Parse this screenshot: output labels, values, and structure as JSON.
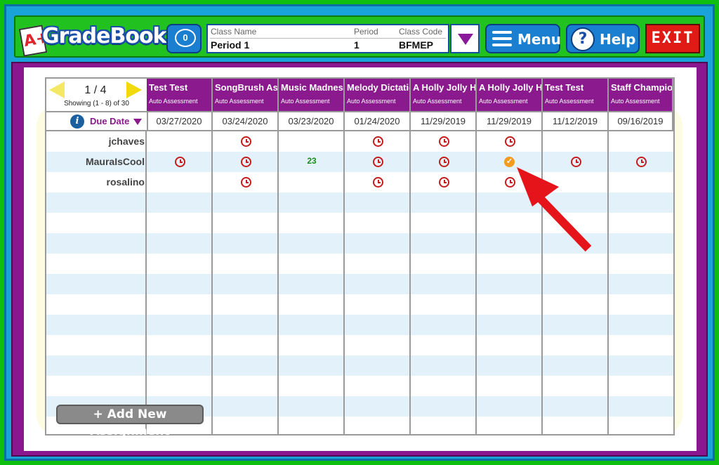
{
  "app": {
    "logo_prefix": "A+",
    "logo_text": "GradeBook"
  },
  "header": {
    "message_count": "0",
    "class_name_label": "Class Name",
    "class_name_value": "Period 1",
    "period_label": "Period",
    "period_value": "1",
    "class_code_label": "Class Code",
    "class_code_value": "BFMEP",
    "menu_label": "Menu",
    "help_label": "Help",
    "exit_label": "EXIT"
  },
  "pager": {
    "page": "1 / 4",
    "showing": "Showing (1 - 8) of 30"
  },
  "due_date_label": "Due Date",
  "assignments": [
    {
      "title": "Test Test",
      "type": "Auto Assessment",
      "due": "03/27/2020"
    },
    {
      "title": "SongBrush Assignment",
      "type": "Auto Assessment",
      "due": "03/24/2020"
    },
    {
      "title": "Music Madness",
      "type": "Auto Assessment",
      "due": "03/23/2020"
    },
    {
      "title": "Melody Dictation",
      "type": "Auto Assessment",
      "due": "01/24/2020"
    },
    {
      "title": "A Holly Jolly Holiday",
      "type": "Auto Assessment",
      "due": "11/29/2019"
    },
    {
      "title": "A Holly Jolly Holiday",
      "type": "Auto Assessment",
      "due": "11/29/2019"
    },
    {
      "title": "Test Test",
      "type": "Auto Assessment",
      "due": "11/12/2019"
    },
    {
      "title": "Staff Champion",
      "type": "Auto Assessment",
      "due": "09/16/2019"
    }
  ],
  "students": [
    {
      "name": "jchaves",
      "cells": [
        "",
        "clock",
        "",
        "clock",
        "clock",
        "clock",
        "",
        ""
      ]
    },
    {
      "name": "MauraIsCool",
      "cells": [
        "clock",
        "clock",
        "23",
        "clock",
        "clock",
        "check",
        "clock",
        "clock"
      ]
    },
    {
      "name": "rosalino",
      "cells": [
        "",
        "clock",
        "",
        "clock",
        "clock",
        "clock",
        "",
        ""
      ]
    }
  ],
  "add_assignment_label": "+ Add New Assignment",
  "colors": {
    "header_purple": "#8a1a8e",
    "clock_red": "#c51d1d",
    "check_orange": "#f29b1d",
    "score_green": "#1c8a1c",
    "arrow_red": "#e4141a"
  }
}
